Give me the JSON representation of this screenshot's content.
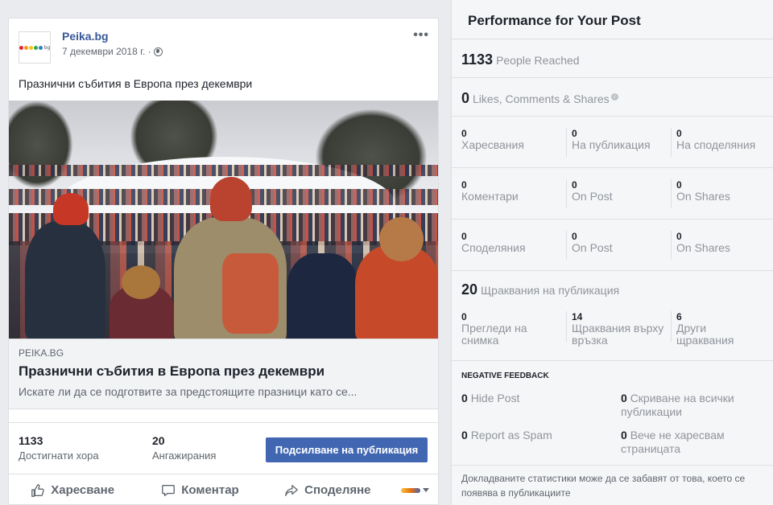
{
  "post": {
    "page_name": "Peika.bg",
    "date": "7 декември 2018 г. ·",
    "more": "•••",
    "text": "Празнични събития в Европа през декември",
    "link": {
      "domain": "PEIKA.BG",
      "title": "Празнични събития в Европа през декември",
      "description": "Искате ли да се подготвите за предстоящите празници като се..."
    },
    "stats": {
      "reached_num": "1133",
      "reached_label": "Достигнати хора",
      "engage_num": "20",
      "engage_label": "Ангажирания"
    },
    "boost_label": "Подсилване на публикация",
    "actions": {
      "like": "Харесване",
      "comment": "Коментар",
      "share": "Споделяне"
    }
  },
  "panel": {
    "title": "Performance for Your Post",
    "reached": {
      "num": "1133",
      "label": "People Reached"
    },
    "reactions": {
      "num": "0",
      "label": "Likes, Comments & Shares"
    },
    "rows": [
      {
        "cells": [
          {
            "num": "0",
            "label": "Харесвания"
          },
          {
            "num": "0",
            "label": "На публикация"
          },
          {
            "num": "0",
            "label": "На споделяния"
          }
        ]
      },
      {
        "cells": [
          {
            "num": "0",
            "label": "Коментари"
          },
          {
            "num": "0",
            "label": "On Post"
          },
          {
            "num": "0",
            "label": "On Shares"
          }
        ]
      },
      {
        "cells": [
          {
            "num": "0",
            "label": "Споделяния"
          },
          {
            "num": "0",
            "label": "On Post"
          },
          {
            "num": "0",
            "label": "On Shares"
          }
        ]
      }
    ],
    "clicks": {
      "num": "20",
      "label": "Щраквания на публикация"
    },
    "click_cells": [
      {
        "num": "0",
        "label": "Прегледи на снимка"
      },
      {
        "num": "14",
        "label": "Щраквания върху връзка"
      },
      {
        "num": "6",
        "label": "Други щраквания"
      }
    ],
    "negative": {
      "title": "NEGATIVE FEEDBACK",
      "hide_post": {
        "num": "0",
        "label": "Hide Post"
      },
      "hide_all": {
        "num": "0",
        "label": "Скриване на всички публикации"
      },
      "spam": {
        "num": "0",
        "label": "Report as Spam"
      },
      "unlike": {
        "num": "0",
        "label": "Вече не харесвам страницата"
      }
    },
    "footnote": "Докладваните статистики може да се забавят от това, което се появява в публикациите"
  },
  "colors": {
    "link_blue": "#385898",
    "button_blue": "#4267b2"
  }
}
